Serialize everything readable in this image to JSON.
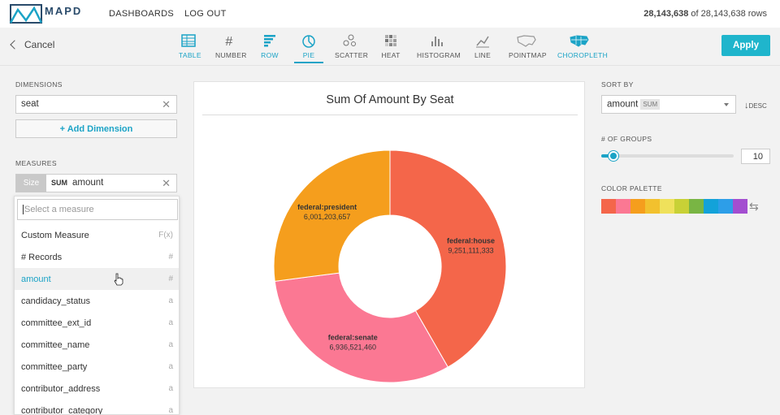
{
  "nav": {
    "logo_text": "MAPD",
    "dashboards": "DASHBOARDS",
    "logout": "LOG OUT",
    "rows_shown": "28,143,638",
    "rows_of": "of 28,143,638 rows"
  },
  "typebar": {
    "cancel": "Cancel",
    "apply": "Apply",
    "types": [
      {
        "label": "TABLE"
      },
      {
        "label": "NUMBER"
      },
      {
        "label": "ROW"
      },
      {
        "label": "PIE"
      },
      {
        "label": "SCATTER"
      },
      {
        "label": "HEAT"
      },
      {
        "label": "HISTOGRAM"
      },
      {
        "label": "LINE"
      },
      {
        "label": "POINTMAP"
      },
      {
        "label": "CHOROPLETH"
      }
    ],
    "active": "PIE"
  },
  "left": {
    "dimensions_label": "DIMENSIONS",
    "dimension_value": "seat",
    "add_dimension": "+ Add Dimension",
    "measures_label": "MEASURES",
    "measure_size": "Size",
    "measure_agg": "SUM",
    "measure_name": "amount",
    "dropdown": {
      "placeholder": "Select a measure",
      "items": [
        {
          "label": "Custom Measure",
          "type": "F(x)"
        },
        {
          "label": "# Records",
          "type": "#"
        },
        {
          "label": "amount",
          "type": "#"
        },
        {
          "label": "candidacy_status",
          "type": "a"
        },
        {
          "label": "committee_ext_id",
          "type": "a"
        },
        {
          "label": "committee_name",
          "type": "a"
        },
        {
          "label": "committee_party",
          "type": "a"
        },
        {
          "label": "contributor_address",
          "type": "a"
        },
        {
          "label": "contributor_category",
          "type": "a"
        }
      ]
    }
  },
  "chart_data": {
    "type": "pie",
    "title": "Sum Of Amount By Seat",
    "donut": true,
    "slices": [
      {
        "label": "federal:house",
        "value": 9251111333,
        "display": "9,251,111,333",
        "color": "#f4664a"
      },
      {
        "label": "federal:senate",
        "value": 6936521460,
        "display": "6,936,521,460",
        "color": "#fb7893"
      },
      {
        "label": "federal:president",
        "value": 6001203657,
        "display": "6,001,203,657",
        "color": "#f59e1d"
      }
    ]
  },
  "right": {
    "sort_by_label": "SORT BY",
    "sort_field": "amount",
    "sort_agg": "SUM",
    "sort_dir": "DESC",
    "groups_label": "# OF GROUPS",
    "groups_value": "10",
    "groups_min": 1,
    "groups_max": 100,
    "palette_label": "COLOR PALETTE",
    "palette": [
      "#f4664a",
      "#fb7893",
      "#f59e1d",
      "#f2c12e",
      "#efe15b",
      "#c8d136",
      "#79b544",
      "#13a2d9",
      "#2d9ee8",
      "#a34ed0"
    ]
  }
}
